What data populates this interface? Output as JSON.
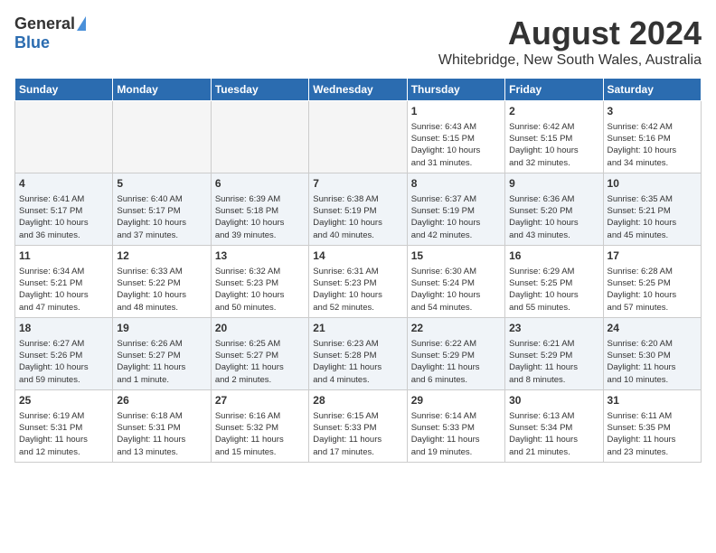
{
  "header": {
    "logo_general": "General",
    "logo_blue": "Blue",
    "month": "August 2024",
    "location": "Whitebridge, New South Wales, Australia"
  },
  "weekdays": [
    "Sunday",
    "Monday",
    "Tuesday",
    "Wednesday",
    "Thursday",
    "Friday",
    "Saturday"
  ],
  "weeks": [
    [
      {
        "day": "",
        "info": ""
      },
      {
        "day": "",
        "info": ""
      },
      {
        "day": "",
        "info": ""
      },
      {
        "day": "",
        "info": ""
      },
      {
        "day": "1",
        "info": "Sunrise: 6:43 AM\nSunset: 5:15 PM\nDaylight: 10 hours\nand 31 minutes."
      },
      {
        "day": "2",
        "info": "Sunrise: 6:42 AM\nSunset: 5:15 PM\nDaylight: 10 hours\nand 32 minutes."
      },
      {
        "day": "3",
        "info": "Sunrise: 6:42 AM\nSunset: 5:16 PM\nDaylight: 10 hours\nand 34 minutes."
      }
    ],
    [
      {
        "day": "4",
        "info": "Sunrise: 6:41 AM\nSunset: 5:17 PM\nDaylight: 10 hours\nand 36 minutes."
      },
      {
        "day": "5",
        "info": "Sunrise: 6:40 AM\nSunset: 5:17 PM\nDaylight: 10 hours\nand 37 minutes."
      },
      {
        "day": "6",
        "info": "Sunrise: 6:39 AM\nSunset: 5:18 PM\nDaylight: 10 hours\nand 39 minutes."
      },
      {
        "day": "7",
        "info": "Sunrise: 6:38 AM\nSunset: 5:19 PM\nDaylight: 10 hours\nand 40 minutes."
      },
      {
        "day": "8",
        "info": "Sunrise: 6:37 AM\nSunset: 5:19 PM\nDaylight: 10 hours\nand 42 minutes."
      },
      {
        "day": "9",
        "info": "Sunrise: 6:36 AM\nSunset: 5:20 PM\nDaylight: 10 hours\nand 43 minutes."
      },
      {
        "day": "10",
        "info": "Sunrise: 6:35 AM\nSunset: 5:21 PM\nDaylight: 10 hours\nand 45 minutes."
      }
    ],
    [
      {
        "day": "11",
        "info": "Sunrise: 6:34 AM\nSunset: 5:21 PM\nDaylight: 10 hours\nand 47 minutes."
      },
      {
        "day": "12",
        "info": "Sunrise: 6:33 AM\nSunset: 5:22 PM\nDaylight: 10 hours\nand 48 minutes."
      },
      {
        "day": "13",
        "info": "Sunrise: 6:32 AM\nSunset: 5:23 PM\nDaylight: 10 hours\nand 50 minutes."
      },
      {
        "day": "14",
        "info": "Sunrise: 6:31 AM\nSunset: 5:23 PM\nDaylight: 10 hours\nand 52 minutes."
      },
      {
        "day": "15",
        "info": "Sunrise: 6:30 AM\nSunset: 5:24 PM\nDaylight: 10 hours\nand 54 minutes."
      },
      {
        "day": "16",
        "info": "Sunrise: 6:29 AM\nSunset: 5:25 PM\nDaylight: 10 hours\nand 55 minutes."
      },
      {
        "day": "17",
        "info": "Sunrise: 6:28 AM\nSunset: 5:25 PM\nDaylight: 10 hours\nand 57 minutes."
      }
    ],
    [
      {
        "day": "18",
        "info": "Sunrise: 6:27 AM\nSunset: 5:26 PM\nDaylight: 10 hours\nand 59 minutes."
      },
      {
        "day": "19",
        "info": "Sunrise: 6:26 AM\nSunset: 5:27 PM\nDaylight: 11 hours\nand 1 minute."
      },
      {
        "day": "20",
        "info": "Sunrise: 6:25 AM\nSunset: 5:27 PM\nDaylight: 11 hours\nand 2 minutes."
      },
      {
        "day": "21",
        "info": "Sunrise: 6:23 AM\nSunset: 5:28 PM\nDaylight: 11 hours\nand 4 minutes."
      },
      {
        "day": "22",
        "info": "Sunrise: 6:22 AM\nSunset: 5:29 PM\nDaylight: 11 hours\nand 6 minutes."
      },
      {
        "day": "23",
        "info": "Sunrise: 6:21 AM\nSunset: 5:29 PM\nDaylight: 11 hours\nand 8 minutes."
      },
      {
        "day": "24",
        "info": "Sunrise: 6:20 AM\nSunset: 5:30 PM\nDaylight: 11 hours\nand 10 minutes."
      }
    ],
    [
      {
        "day": "25",
        "info": "Sunrise: 6:19 AM\nSunset: 5:31 PM\nDaylight: 11 hours\nand 12 minutes."
      },
      {
        "day": "26",
        "info": "Sunrise: 6:18 AM\nSunset: 5:31 PM\nDaylight: 11 hours\nand 13 minutes."
      },
      {
        "day": "27",
        "info": "Sunrise: 6:16 AM\nSunset: 5:32 PM\nDaylight: 11 hours\nand 15 minutes."
      },
      {
        "day": "28",
        "info": "Sunrise: 6:15 AM\nSunset: 5:33 PM\nDaylight: 11 hours\nand 17 minutes."
      },
      {
        "day": "29",
        "info": "Sunrise: 6:14 AM\nSunset: 5:33 PM\nDaylight: 11 hours\nand 19 minutes."
      },
      {
        "day": "30",
        "info": "Sunrise: 6:13 AM\nSunset: 5:34 PM\nDaylight: 11 hours\nand 21 minutes."
      },
      {
        "day": "31",
        "info": "Sunrise: 6:11 AM\nSunset: 5:35 PM\nDaylight: 11 hours\nand 23 minutes."
      }
    ]
  ]
}
